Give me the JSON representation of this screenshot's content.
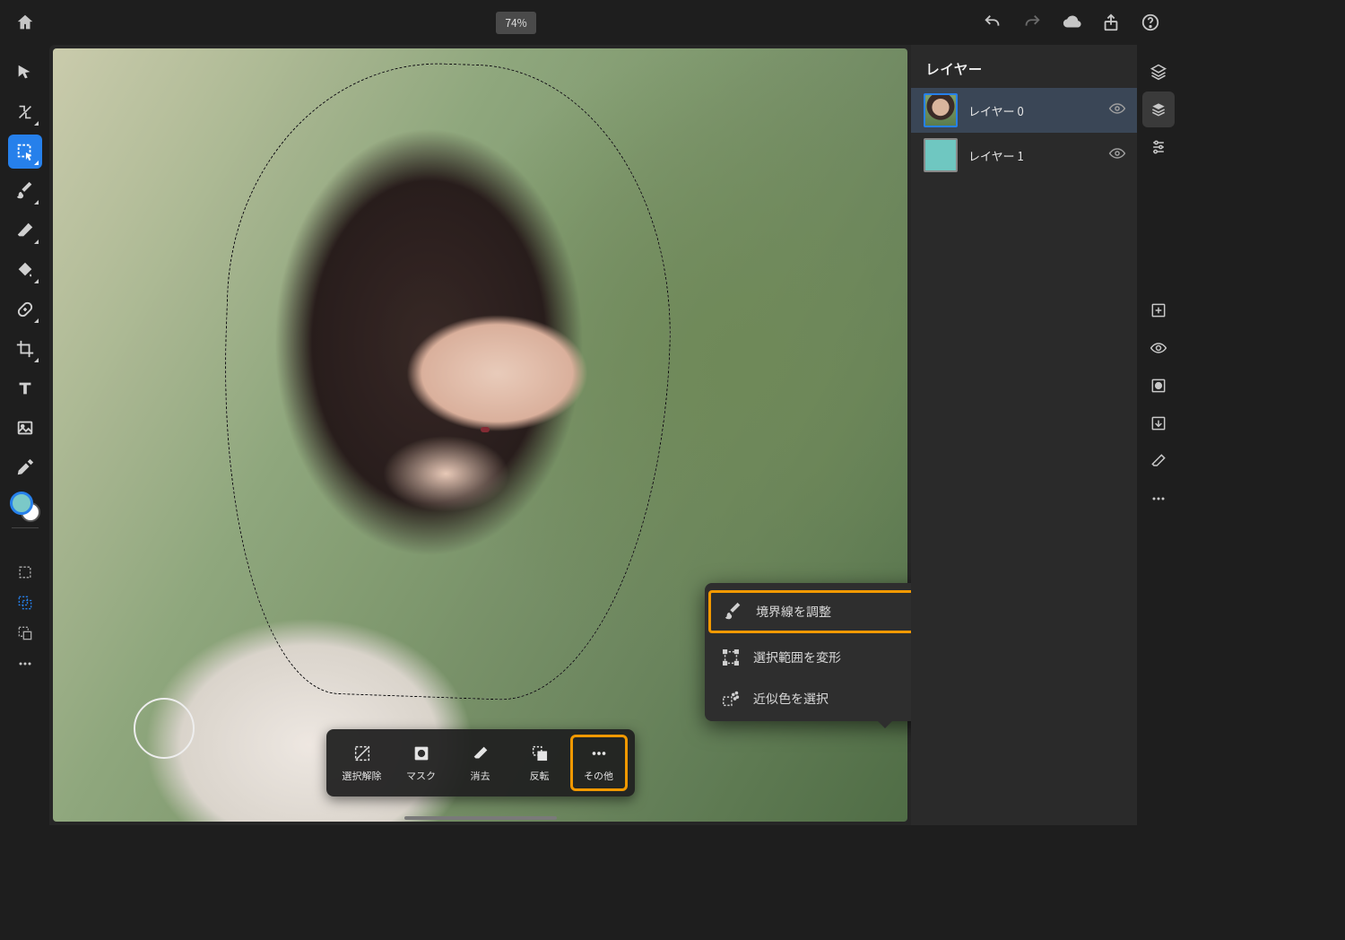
{
  "topbar": {
    "zoom": "74%"
  },
  "layers": {
    "title": "レイヤー",
    "items": [
      {
        "name": "レイヤー 0",
        "selected": true
      },
      {
        "name": "レイヤー 1",
        "selected": false
      }
    ]
  },
  "selectionBar": {
    "deselect": "選択解除",
    "mask": "マスク",
    "erase": "消去",
    "invert": "反転",
    "more": "その他"
  },
  "popover": {
    "refineEdge": "境界線を調整",
    "transformSelection": "選択範囲を変形",
    "selectSimilar": "近似色を選択"
  },
  "icons": {
    "home": "home-icon",
    "undo": "undo-icon",
    "redo": "redo-icon",
    "cloud": "cloud-icon",
    "share": "share-icon",
    "help": "help-icon"
  }
}
